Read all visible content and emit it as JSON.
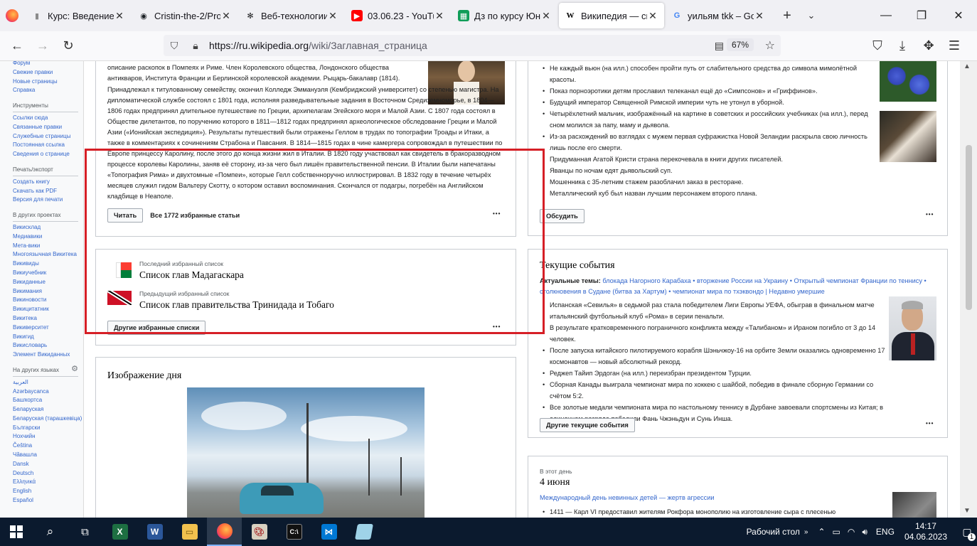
{
  "browser": {
    "tabs": [
      {
        "label": "Курс: Введение в",
        "icon": "bookmark-icon",
        "color": "#8b8b8b",
        "active": false
      },
      {
        "label": "Cristin-the-2/Proj",
        "icon": "github-icon",
        "color": "#1b1f24",
        "active": false
      },
      {
        "label": "Веб-технологии:",
        "icon": "openai-icon",
        "color": "#202123",
        "active": false
      },
      {
        "label": "03.06.23 - YouTub",
        "icon": "youtube-icon",
        "color": "#ff0000",
        "active": false
      },
      {
        "label": "Дз по курсу Юни",
        "icon": "sheets-icon",
        "color": "#0f9d58",
        "active": false
      },
      {
        "label": "Википедия — сво",
        "icon": "wikipedia-icon",
        "color": "#000000",
        "active": true
      },
      {
        "label": "уильям tkk – Goo",
        "icon": "google-icon",
        "color": "#4285f4",
        "active": false
      }
    ],
    "url_host": "https://ru.wikipedia.org",
    "url_path": "/wiki/Заглавная_страница",
    "zoom": "67%"
  },
  "sidebar": {
    "top_links": [
      "Форум",
      "Свежие правки",
      "Новые страницы",
      "Справка"
    ],
    "tools_heading": "Инструменты",
    "tools": [
      "Ссылки сюда",
      "Связанные правки",
      "Служебные страницы",
      "Постоянная ссылка",
      "Сведения о странице"
    ],
    "print_heading": "Печать/экспорт",
    "print": [
      "Создать книгу",
      "Скачать как PDF",
      "Версия для печати"
    ],
    "projects_heading": "В других проектах",
    "projects": [
      "Викисклад",
      "Медиавики",
      "Мета-вики",
      "Многоязычная Викитека",
      "Викивиды",
      "Викиучебник",
      "Викиданные",
      "Викимания",
      "Викиновости",
      "Викицитатник",
      "Викитека",
      "Викиверситет",
      "Викигид",
      "Викисловарь",
      "Элемент Викиданных"
    ],
    "languages_heading": "На других языках",
    "languages": [
      "العربية",
      "Azərbaycanca",
      "Башҡортса",
      "Беларуская",
      "Беларуская (тарашкевіца)",
      "Български",
      "Нохчийн",
      "Čeština",
      "Чӑвашла",
      "Dansk",
      "Deutsch",
      "Ελληνικά",
      "English",
      "Español"
    ]
  },
  "featured_article": {
    "top_line": "описание раскопок в Помпеях и Риме. Член Королевского общества, Лондонского общества антикваров, Института Франции и Берлинской королевской академии. Рыцарь-бакалавр (1814).",
    "paragraph": "Принадлежал к титулованному семейству, окончил Колледж Эммануэля (Кембриджский университет) со степенью магистра. На дипломатической службе состоял с 1801 года, исполняя разведывательные задания в Восточном Средиземноморье, в 1804—1806 годах предпринял длительное путешествие по Греции, архипелагам Эгейского моря и Малой Азии. С 1807 года состоял в Обществе дилетантов, по поручению которого в 1811—1812 годах предпринял археологическое обследование Греции и Малой Азии («Ионийская экспедиция»). Результаты путешествий были отражены Геллом в трудах по топографии Троады и Итаки, а также в комментариях к сочинениям Страбона и Павсания. В 1814—1815 годах в чине камергера сопровождал в путешествии по Европе принцессу Каролину, после этого до конца жизни жил в Италии. В 1820 году участвовал как свидетель в бракоразводном процессе королевы Каролины, заняв её сторону, из-за чего был лишён правительственной пенсии. В Италии были напечатаны «Топография Рима» и двухтомные «Помпеи», которые Гелл собственноручно иллюстрировал. В 1832 году в течение четырёх месяцев служил гидом Вальтеру Скотту, о котором оставил воспоминания. Скончался от подагры, погребён на Английском кладбище в Неаполе.",
    "read_button": "Читать",
    "all_link": "Все 1772 избранные статьи",
    "more": "•••"
  },
  "featured_lists": {
    "last_label": "Последний избранный список",
    "last_title": "Список глав Мадагаскара",
    "prev_label": "Предыдущий избранный список",
    "prev_title": "Список глав правительства Тринидада и Тобаго",
    "other_button": "Другие избранные списки",
    "more": "•••"
  },
  "picture_of_day": {
    "heading": "Изображение дня"
  },
  "did_you_know": {
    "items": [
      "Не каждый вьюн (на илл.) способен пройти путь от слабительного средства до символа мимолётной красоты.",
      "Показ порноэротики детям прославил телеканал ещё до «Симпсонов» и «Гриффинов».",
      "Будущий император Священной Римской империи чуть не утонул в уборной.",
      "Четырёхлетний мальчик, изображённый на картине в советских и российских учебниках (на илл.), перед сном молился за папу, маму и дьявола.",
      "Из-за расхождений во взглядах с мужем первая суфражистка Новой Зеландии раскрыла свою личность лишь после его смерти.",
      "Придуманная Агатой Кристи страна перекочевала в книги других писателей.",
      "Яванцы по ночам едят дьявольский суп.",
      "Мошенника с 35-летним стажем разоблачил заказ в ресторане.",
      "Металлический куб был назван лучшим персонажем второго плана."
    ],
    "discuss_button": "Обсудить",
    "more": "•••"
  },
  "current_events": {
    "heading": "Текущие события",
    "topics_label": "Актуальные темы:",
    "topics": "блокада Нагорного Карабаха • вторжение России на Украину • Открытый чемпионат Франции по теннису • столкновения в Судане (битва за Хартум) • чемпионат мира по тхэквондо | Недавно умершие",
    "items": [
      "Испанская «Севилья» в седьмой раз стала победителем Лиги Европы УЕФА, обыграв в финальном матче итальянский футбольный клуб «Рома» в серии пенальти.",
      "В результате кратковременного пограничного конфликта между «Талибаном» и Ираном погибло от 3 до 14 человек.",
      "После запуска китайского пилотируемого корабля Шэньчжоу-16 на орбите Земли оказались одновременно 17 космонавтов — новый абсолютный рекорд.",
      "Реджеп Тайип Эрдоган (на илл.) переизбран президентом Турции.",
      "Сборная Канады выиграла чемпионат мира по хоккею с шайбой, победив в финале сборную Германии со счётом 5:2.",
      "Все золотые медали чемпионата мира по настольному теннису в Дурбане завоевали спортсмены из Китая; в одиночном разряде победили Фань Чжэньдун и Сунь Инша."
    ],
    "other_button": "Другие текущие события",
    "more": "•••"
  },
  "this_day": {
    "label": "В этот день",
    "date": "4 июня",
    "observance": "Международный день невинных детей — жертв агрессии",
    "first_item": "1411 — Карл VI предоставил жителям Рокфора монополию на изготовление сыра с плесенью"
  },
  "taskbar": {
    "desktop_label": "Рабочий стол",
    "lang": "ENG",
    "time": "14:17",
    "date": "04.06.2023",
    "notif_count": "1"
  }
}
